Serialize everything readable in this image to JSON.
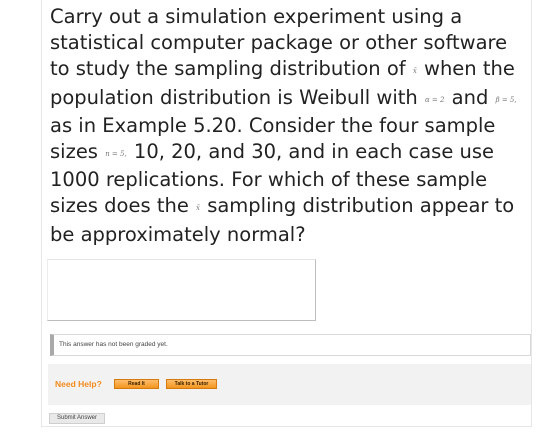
{
  "question": {
    "part1": "Carry out a simulation experiment using a statistical computer package or other software to study the sampling distribution of",
    "xbar_symbol": "x̄",
    "part2": "when the population distribution is Weibull with",
    "alpha_eq": "α = 2",
    "part3": "and",
    "beta_eq": "β = 5,",
    "part4": "as in Example 5.20. Consider the four sample sizes",
    "n_eq": "n = 5,",
    "part5": "10, 20, and 30, and in each case use 1000 replications. For which of these sample sizes does the",
    "xbar_symbol_2": "x̄",
    "part6": "sampling distribution appear to be approximately normal?"
  },
  "answer": {
    "value": ""
  },
  "status": {
    "text": "This answer has not been graded yet."
  },
  "help": {
    "label": "Need Help?",
    "read_it": "Read It",
    "talk_to_tutor": "Talk to a Tutor"
  },
  "submit": {
    "label": "Submit Answer"
  },
  "colors": {
    "accent_orange": "#f28b1e",
    "status_border": "#a9a9a9"
  }
}
